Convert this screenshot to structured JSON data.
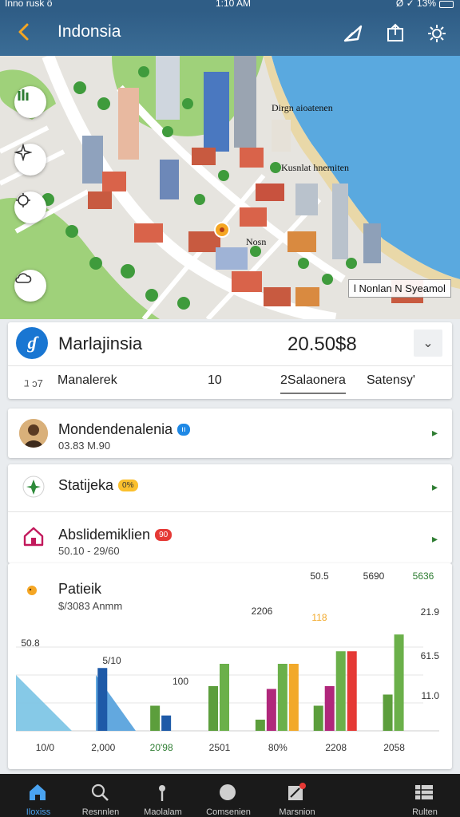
{
  "status": {
    "left": "Inno rusk ö",
    "time": "1:10 AM",
    "right": "Ø ✓ 13%"
  },
  "appbar": {
    "title": "Indonsia"
  },
  "map": {
    "labels": [
      "Dirgn aioatenen",
      "Kusnlat hnemiten",
      "Nosn",
      "l Nonlan N Syeamol"
    ],
    "colors": {
      "water": "#5aa9df",
      "park": "#9fd17a",
      "road": "#ffffff"
    }
  },
  "summary": {
    "name": "Marlajinsia",
    "value": "20.50$8",
    "tabs": [
      "Manalerek",
      "10",
      "2Salaonera",
      "Satensy'"
    ],
    "tab_prefix": "ﾕ ɔ7"
  },
  "rows": [
    {
      "title": "Mondendenalenia",
      "badge": "ıı",
      "sub": "03.83 M.90",
      "badge_color": "#1e88e5"
    },
    {
      "title": "Statijeka",
      "badge": "0%",
      "sub": "",
      "badge_color": "#fbc02d"
    },
    {
      "title": "Abslidemiklien",
      "badge": "90",
      "sub": "50.10 - 29/60",
      "badge_color": "#e53935"
    }
  ],
  "chart": {
    "title": "Patieik",
    "subtitle": "$/3083 Anmm"
  },
  "chart_data": {
    "type": "bar",
    "categories": [
      "10/0",
      "2,000",
      "20'98",
      "2501",
      "80%",
      "2208",
      "2058"
    ],
    "series_values": [
      {
        "name": "",
        "values": [
          0,
          0,
          18,
          32,
          8,
          18,
          26
        ],
        "color": "#5c9e3c"
      },
      {
        "name": "",
        "values": [
          0,
          0,
          0,
          0,
          30,
          32,
          0
        ],
        "color": "#b0277b"
      },
      {
        "name": "",
        "values": [
          0,
          0,
          0,
          48,
          48,
          57,
          69
        ],
        "color": "#6bb04a"
      },
      {
        "name": "",
        "values": [
          0,
          0,
          0,
          0,
          48,
          0,
          0
        ],
        "color": "#f2a92a"
      },
      {
        "name": "",
        "values": [
          0,
          0,
          0,
          0,
          0,
          57,
          0
        ],
        "color": "#e53935"
      },
      {
        "name": "",
        "values": [
          0,
          45,
          11,
          0,
          0,
          0,
          0
        ],
        "color": "#1e5aa8"
      }
    ],
    "area_series": [
      {
        "name": "",
        "values": [
          40,
          0
        ],
        "color": "#7fc6e6"
      },
      {
        "name": "",
        "values": [
          40,
          0
        ],
        "color": "#5aa3dd"
      }
    ],
    "data_labels": [
      "50.8",
      "5/10",
      "100",
      "2206",
      "118",
      "50.5",
      "5690",
      "5636"
    ],
    "y_ticks": [
      "21.9",
      "61.5",
      "11.0"
    ],
    "ylim": [
      0,
      80
    ],
    "grid": true
  },
  "nav": [
    {
      "label": "Iloxiss",
      "icon": "home-icon"
    },
    {
      "label": "Resnnlen",
      "icon": "search-icon"
    },
    {
      "label": "Maolalam",
      "icon": "pin-icon"
    },
    {
      "label": "Comsenien",
      "icon": "compass-icon"
    },
    {
      "label": "Marsnion",
      "icon": "map-alert-icon"
    },
    {
      "label": "Rulten",
      "icon": "grid-icon"
    }
  ]
}
